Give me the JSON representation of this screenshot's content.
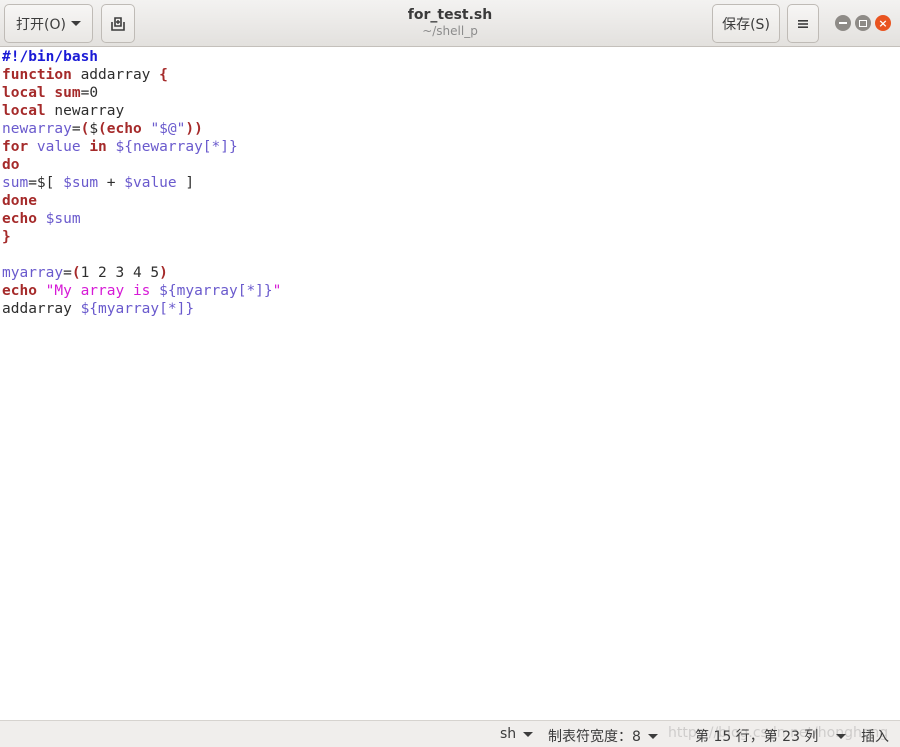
{
  "header": {
    "open_label": "打开(O)",
    "save_label": "保存(S)",
    "title": "for_test.sh",
    "subtitle": "~/shell_p"
  },
  "editor": {
    "lines": [
      [
        {
          "t": "#!/bin/bash",
          "c": "pp"
        }
      ],
      [
        {
          "t": "function",
          "c": "kw"
        },
        {
          "t": " addarray ",
          "c": ""
        },
        {
          "t": "{",
          "c": "br"
        }
      ],
      [
        {
          "t": "local",
          "c": "kw"
        },
        {
          "t": " ",
          "c": ""
        },
        {
          "t": "sum",
          "c": "kw"
        },
        {
          "t": "=0",
          "c": ""
        }
      ],
      [
        {
          "t": "local",
          "c": "kw"
        },
        {
          "t": " newarray",
          "c": ""
        }
      ],
      [
        {
          "t": "newarray",
          "c": "var"
        },
        {
          "t": "=",
          "c": ""
        },
        {
          "t": "(",
          "c": "br"
        },
        {
          "t": "$",
          "c": ""
        },
        {
          "t": "(",
          "c": "br"
        },
        {
          "t": "echo",
          "c": "kw"
        },
        {
          "t": " ",
          "c": ""
        },
        {
          "t": "\"$@\"",
          "c": "var"
        },
        {
          "t": "))",
          "c": "br"
        }
      ],
      [
        {
          "t": "for",
          "c": "kw"
        },
        {
          "t": " value ",
          "c": "var"
        },
        {
          "t": "in",
          "c": "kw"
        },
        {
          "t": " ${newarray[*]}",
          "c": "var"
        }
      ],
      [
        {
          "t": "do",
          "c": "kw"
        }
      ],
      [
        {
          "t": "sum",
          "c": "var"
        },
        {
          "t": "=$[ ",
          "c": ""
        },
        {
          "t": "$sum",
          "c": "var"
        },
        {
          "t": " + ",
          "c": ""
        },
        {
          "t": "$value",
          "c": "var"
        },
        {
          "t": " ]",
          "c": ""
        }
      ],
      [
        {
          "t": "done",
          "c": "kw"
        }
      ],
      [
        {
          "t": "echo",
          "c": "kw"
        },
        {
          "t": " ",
          "c": ""
        },
        {
          "t": "$sum",
          "c": "var"
        }
      ],
      [
        {
          "t": "}",
          "c": "br"
        }
      ],
      [],
      [
        {
          "t": "myarray",
          "c": "var"
        },
        {
          "t": "=",
          "c": ""
        },
        {
          "t": "(",
          "c": "br"
        },
        {
          "t": "1 2 3 4 5",
          "c": ""
        },
        {
          "t": ")",
          "c": "br"
        }
      ],
      [
        {
          "t": "echo",
          "c": "kw"
        },
        {
          "t": " ",
          "c": ""
        },
        {
          "t": "\"My array is ",
          "c": "str"
        },
        {
          "t": "${myarray[*]}",
          "c": "var"
        },
        {
          "t": "\"",
          "c": "str"
        }
      ],
      [
        {
          "t": "addarray ",
          "c": ""
        },
        {
          "t": "${myarray[*]}",
          "c": "var"
        }
      ]
    ]
  },
  "statusbar": {
    "language": "sh",
    "tab_width": "制表符宽度：8",
    "cursor_position": "第 15 行，第 23 列",
    "insert_mode": "插入",
    "watermark": "https://blog.csdn.net/honghong"
  },
  "colors": {
    "keyword": "#a52a2a",
    "shebang": "#1a1ad6",
    "variable": "#6a5acd",
    "string": "#d61ad6",
    "close_button": "#e95420"
  },
  "icons": {
    "open_dropdown": "chevron-down-icon",
    "new_document": "new-document-icon",
    "menu": "hamburger-menu-icon",
    "minimize": "minimize-icon",
    "maximize": "maximize-icon",
    "close": "close-icon"
  }
}
